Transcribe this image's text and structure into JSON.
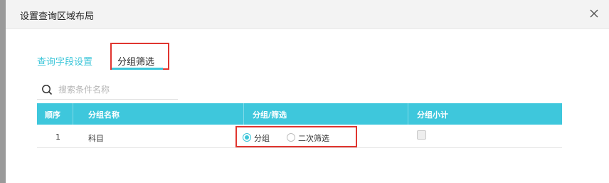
{
  "dialog": {
    "title": "设置查询区域布局",
    "close_icon": "close-icon"
  },
  "tabs": [
    {
      "label": "查询字段设置",
      "active": false
    },
    {
      "label": "分组筛选",
      "active": true
    }
  ],
  "search": {
    "placeholder": "搜索条件名称",
    "value": "",
    "icon": "search-icon"
  },
  "table": {
    "columns": [
      "顺序",
      "分组名称",
      "分组/筛选",
      "分组小计"
    ],
    "rows": [
      {
        "order": "1",
        "name": "科目",
        "options": [
          {
            "label": "分组",
            "checked": true
          },
          {
            "label": "二次筛选",
            "checked": false
          }
        ],
        "subtotal_checked": false
      }
    ]
  },
  "colors": {
    "accent": "#3cc6d9",
    "highlight_border": "#e0352f",
    "header_bg": "#3ec7dc"
  }
}
